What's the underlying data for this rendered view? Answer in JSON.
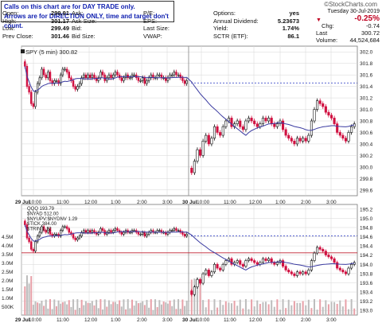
{
  "notice": {
    "line1": "Calls on this chart are for DAY TRADE only.",
    "line2": "Arrows are for DIRECTION ONLY, time and target don't count."
  },
  "brand": "©StockCharts.com",
  "quote": {
    "col1": [
      {
        "label": "Open:",
        "value": "299.91"
      },
      {
        "label": "High:",
        "value": "301.17"
      },
      {
        "label": "Low:",
        "value": "299.49"
      },
      {
        "label": "Prev Close:",
        "value": "301.46"
      }
    ],
    "col2": [
      {
        "label": "Ask:",
        "value": ""
      },
      {
        "label": "Ask Size:",
        "value": ""
      },
      {
        "label": "Bid:",
        "value": ""
      },
      {
        "label": "Bid Size:",
        "value": ""
      }
    ],
    "col3": [
      {
        "label": "P/E:",
        "value": ""
      },
      {
        "label": "EPS:",
        "value": ""
      },
      {
        "label": "Last Size:",
        "value": ""
      },
      {
        "label": "VWAP:",
        "value": ""
      }
    ],
    "col4": [
      {
        "label": "Options:",
        "value": "yes"
      },
      {
        "label": "Annual Dividend:",
        "value": "5.23673"
      },
      {
        "label": "Yield:",
        "value": "1.74%"
      },
      {
        "label": "SCTR (ETF):",
        "value": "86.1"
      }
    ]
  },
  "summary": {
    "date": "Tuesday  30-Jul-2019",
    "pct": "-0.25%",
    "chg_label": "Chg:",
    "chg": "-0.74",
    "last_label": "Last",
    "last": "300.72",
    "vol_label": "Volume:",
    "vol": "44,524,684"
  },
  "chart_data": [
    {
      "type": "candlestick",
      "title": "SPY (5 min) 300.82",
      "y_ticks": [
        299.6,
        299.8,
        300.0,
        300.2,
        300.4,
        300.6,
        300.8,
        301.0,
        301.2,
        301.4,
        301.6,
        301.8,
        302.0
      ],
      "ylim": [
        299.5,
        302.1
      ],
      "x_ticks": [
        "29 Jul",
        "10:00",
        "11:00",
        "12:00",
        "1:00",
        "2:00",
        "3:00",
        "30 Jul",
        "10:00",
        "11:00",
        "12:00",
        "1:00",
        "2:00",
        "3:00"
      ],
      "reference_lines": {
        "prev_close": 301.46,
        "red_level": 301.47
      },
      "sessions": [
        {
          "date": "29 Jul",
          "closes": [
            301.75,
            301.4,
            301.3,
            301.1,
            301.05,
            301.3,
            301.45,
            301.55,
            301.7,
            301.6,
            301.55,
            301.65,
            301.5,
            301.45,
            301.5,
            301.5,
            301.45,
            301.6,
            301.7,
            301.7,
            301.65,
            301.55,
            301.5,
            301.4,
            301.35,
            301.4,
            301.45,
            301.55,
            301.6,
            301.55,
            301.6,
            301.55,
            301.6,
            301.55,
            301.5,
            301.55,
            301.65,
            301.6,
            301.5,
            301.55,
            301.6,
            301.55,
            301.6,
            301.65,
            301.6,
            301.55,
            301.5,
            301.55,
            301.6,
            301.55,
            301.55,
            301.6,
            301.6,
            301.55,
            301.5,
            301.5,
            301.55,
            301.45,
            301.5,
            301.55,
            301.6,
            301.55,
            301.55,
            301.6,
            301.6,
            301.55,
            301.55,
            301.5,
            301.55,
            301.6,
            301.6,
            301.65,
            301.6,
            301.6,
            301.55,
            301.5,
            301.45,
            301.5
          ]
        },
        {
          "date": "30 Jul",
          "closes": [
            299.9,
            300.1,
            300.3,
            300.2,
            300.45,
            300.55,
            300.4,
            300.5,
            300.7,
            300.6,
            300.55,
            300.7,
            300.8,
            300.85,
            300.7,
            300.75,
            300.8,
            300.7,
            300.65,
            300.8,
            300.85,
            300.8,
            300.75,
            300.7,
            300.75,
            300.85,
            300.8,
            300.85,
            300.75,
            300.7,
            300.75,
            300.8,
            300.65,
            300.55,
            300.5,
            300.45,
            300.4,
            300.5,
            300.45,
            300.5,
            300.45,
            300.55,
            300.8,
            301.0,
            301.15,
            301.1,
            301.05,
            300.95,
            300.9,
            300.85,
            300.75,
            300.6,
            300.55,
            300.5,
            300.45,
            300.6,
            300.7,
            300.75
          ]
        }
      ]
    },
    {
      "type": "line-overlay",
      "legend": [
        "QQQ 193.79",
        "$NYAD 512.00",
        "$NYUPV:$NYDNV 1.29",
        "$TICK 384.00",
        "$TRIN 1.12"
      ],
      "y_right_ticks": [
        193.0,
        193.2,
        193.4,
        193.6,
        193.8,
        194.0,
        194.2,
        194.4,
        194.6,
        194.8,
        195.0,
        195.2
      ],
      "y_left_ticks": [
        "4.5M",
        "4.0M",
        "3.5M",
        "3.0M",
        "2.5M",
        "2.0M",
        "1.5M",
        "1.0M",
        "500K"
      ],
      "ylim": [
        192.9,
        195.3
      ],
      "x_ticks": [
        "29 Jul",
        "10:00",
        "11:00",
        "12:00",
        "1:00",
        "2:00",
        "3:00",
        "30 Jul",
        "10:00",
        "11:00",
        "12:00",
        "1:00",
        "2:00",
        "3:00"
      ],
      "reference_lines": {
        "blue_dotted": 194.62,
        "red_level": 194.25
      }
    }
  ],
  "colors": {
    "up": "#111111",
    "down": "#d01040",
    "ma": "#3a3aa0",
    "blue_ref": "#2030c0",
    "red_ref": "#c02030",
    "grid": "#d6d6d6"
  }
}
